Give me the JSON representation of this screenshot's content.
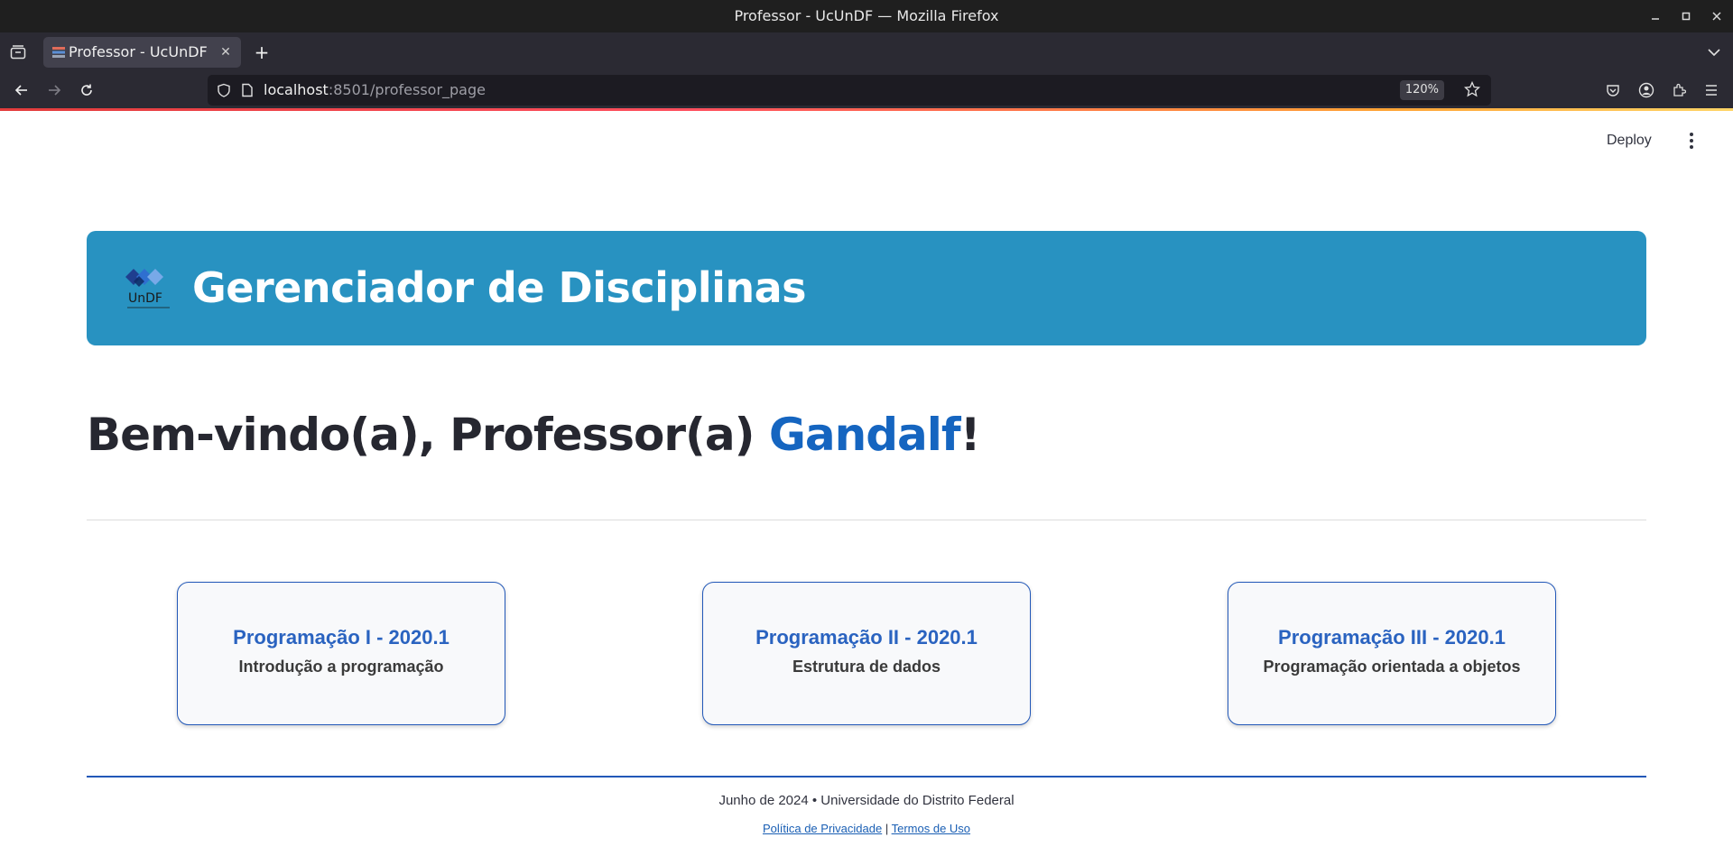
{
  "window": {
    "title": "Professor - UcUnDF — Mozilla Firefox"
  },
  "tabs": [
    {
      "label": "Professor - UcUnDF"
    }
  ],
  "newtab_label": "+",
  "navbar": {
    "url_host": "localhost",
    "url_rest": ":8501/professor_page",
    "zoom": "120%"
  },
  "streamlit": {
    "deploy_label": "Deploy"
  },
  "banner": {
    "title": "Gerenciador de Disciplinas",
    "logo_text": "UnDF"
  },
  "welcome": {
    "prefix": "Bem-vindo(a), Professor(a) ",
    "name": "Gandalf",
    "suffix": "!"
  },
  "courses": [
    {
      "title": "Programação I - 2020.1",
      "subtitle": "Introdução a programação"
    },
    {
      "title": "Programação II - 2020.1",
      "subtitle": "Estrutura de dados"
    },
    {
      "title": "Programação III - 2020.1",
      "subtitle": "Programação orientada a objetos"
    }
  ],
  "footer": {
    "text": "Junho de 2024 • Universidade do Distrito Federal",
    "privacy_link": "Política de Privacidade",
    "separator": "|",
    "terms_link": "Termos de Uso"
  },
  "colors": {
    "banner": "#2892c1",
    "accent": "#1565c0",
    "card_border": "#2258b8"
  }
}
